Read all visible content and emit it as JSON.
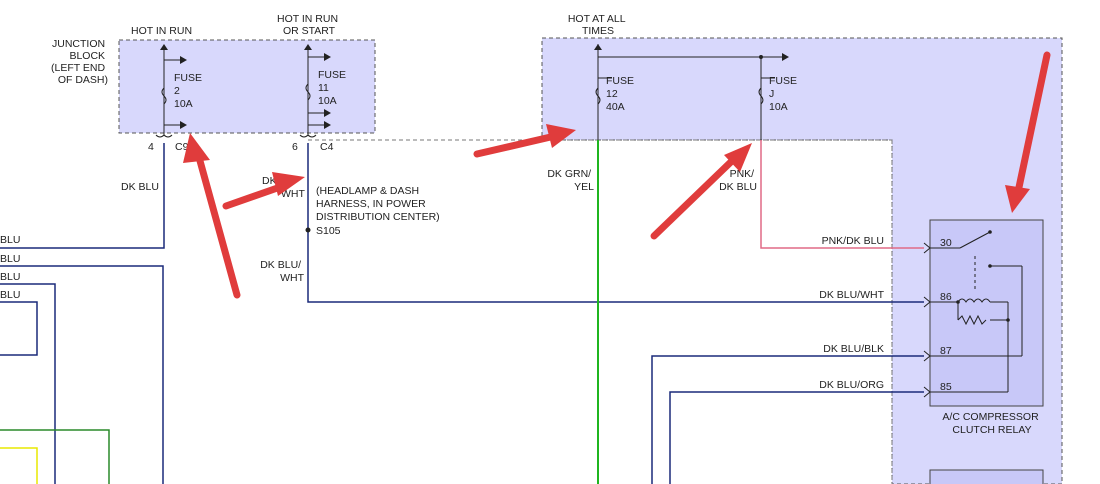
{
  "colors": {
    "box_fill": "#d8d8fc",
    "box_stroke": "#555555",
    "wire_dk_blu": "#1a2a7a",
    "wire_green": "#1fb51f",
    "wire_pink": "#e06a86",
    "wire_yellow": "#e8e800",
    "arrow_red": "#e03c3c"
  },
  "junction_block": {
    "title_lines": [
      "JUNCTION",
      "BLOCK",
      "(LEFT END",
      "OF DASH)"
    ],
    "hot_in_run": "HOT IN RUN",
    "hot_in_run_or_start": [
      "HOT IN RUN",
      "OR START"
    ],
    "fuse2": [
      "FUSE",
      "2",
      "10A"
    ],
    "fuse11": [
      "FUSE",
      "11",
      "10A"
    ],
    "pin_4": "4",
    "conn_c9": "C9",
    "pin_6": "6",
    "conn_c4": "C4"
  },
  "power_center": {
    "hot_at_all_times": [
      "HOT AT ALL",
      "TIMES"
    ],
    "fuse12": [
      "FUSE",
      "12",
      "40A"
    ],
    "fuseJ": [
      "FUSE",
      "J",
      "10A"
    ]
  },
  "wires": {
    "dk_blu": "DK BLU",
    "dk_blu_wht_partial": [
      "DK",
      "WHT"
    ],
    "dk_blu_wht": [
      "DK BLU/",
      "WHT"
    ],
    "splice_note": [
      "(HEADLAMP & DASH",
      "HARNESS, IN POWER",
      "DISTRIBUTION CENTER)"
    ],
    "splice_id": "S105",
    "dk_grn_yel": [
      "DK GRN/",
      "YEL"
    ],
    "pnk_dk_blu_partial": [
      "PNK/",
      "DK BLU"
    ],
    "left_edge_labels": [
      "BLU",
      "BLU",
      "BLU",
      "BLU"
    ]
  },
  "relay": {
    "wires": [
      "PNK/DK BLU",
      "DK BLU/WHT",
      "DK BLU/BLK",
      "DK BLU/ORG"
    ],
    "pins": [
      "30",
      "86",
      "87",
      "85"
    ],
    "name": [
      "A/C COMPRESSOR",
      "CLUTCH RELAY"
    ]
  }
}
